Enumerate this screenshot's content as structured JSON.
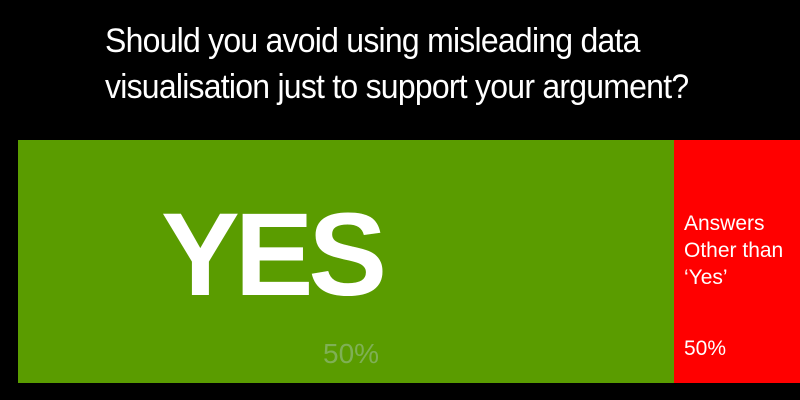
{
  "question": {
    "line1": "Should you avoid using misleading data",
    "line2": "visualisation just to support your argument?"
  },
  "colors": {
    "background": "#000000",
    "yes": "#5a9c00",
    "other": "#ff0000",
    "text": "#ffffff",
    "yes_percent": "#7fb055"
  },
  "chart_data": {
    "type": "bar",
    "orientation": "horizontal-stacked",
    "title": "",
    "categories": [
      "YES",
      "Answers Other than ‘Yes’"
    ],
    "values": [
      50,
      50
    ],
    "value_labels": [
      "50%",
      "50%"
    ],
    "other_label_lines": [
      "Answers",
      "Other than",
      "‘Yes’"
    ]
  }
}
